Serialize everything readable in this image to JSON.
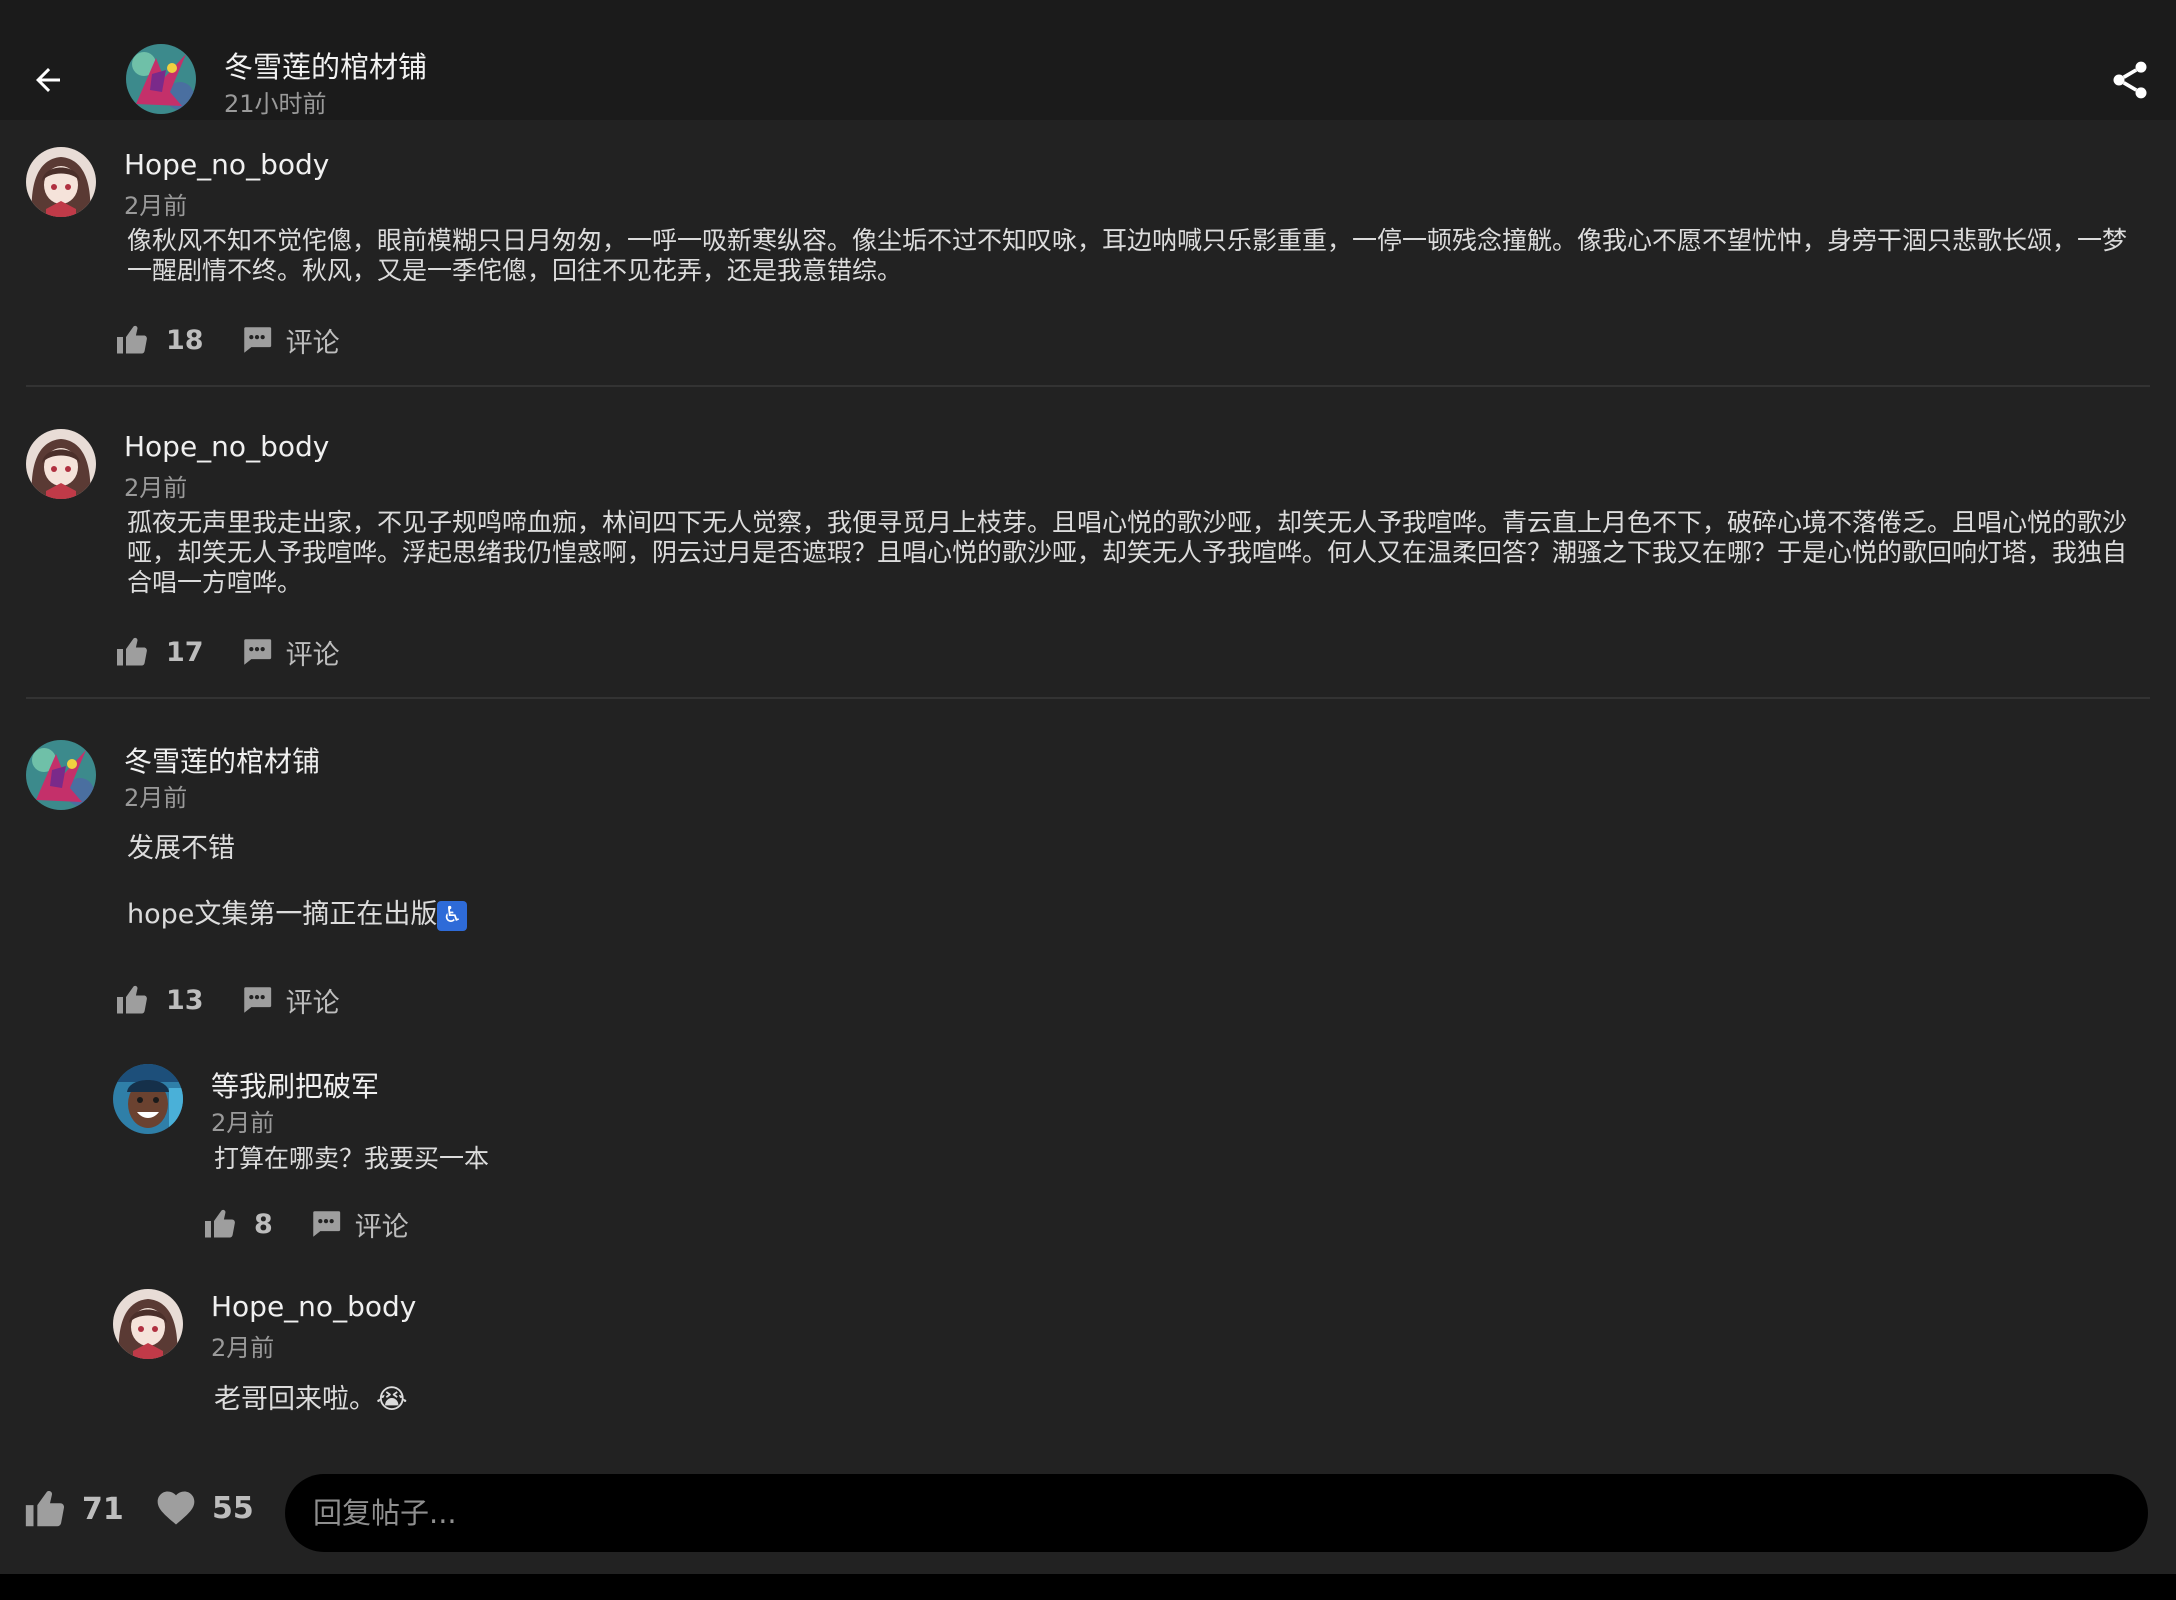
{
  "header": {
    "author": "冬雪莲的棺材铺",
    "time": "21小时前"
  },
  "comments": [
    {
      "user": "Hope_no_body",
      "time": "2月前",
      "text": "像秋风不知不觉侘傯，眼前模糊只日月匆匆，一呼一吸新寒纵容。像尘垢不过不知叹咏，耳边呐喊只乐影重重，一停一顿残念撞觥。像我心不愿不望忧忡，身旁干涸只悲歌长颂，一梦一醒剧情不终。秋风，又是一季侘傯，回往不见花弄，还是我意错综。",
      "likes": "18",
      "reply_label": "评论"
    },
    {
      "user": "Hope_no_body",
      "time": "2月前",
      "text": "孤夜无声里我走出家，不见子规鸣啼血痂，林间四下无人觉察，我便寻觅月上枝芽。且唱心悦的歌沙哑，却笑无人予我喧哗。青云直上月色不下，破碎心境不落倦乏。且唱心悦的歌沙哑，却笑无人予我喧哗。浮起思绪我仍惶惑啊，阴云过月是否遮瑕？且唱心悦的歌沙哑，却笑无人予我喧哗。何人又在温柔回答？潮骚之下我又在哪？于是心悦的歌回响灯塔，我独自合唱一方喧哗。",
      "likes": "17",
      "reply_label": "评论"
    },
    {
      "user": "冬雪莲的棺材铺",
      "time": "2月前",
      "text_line1": "发展不错",
      "text_line2": "hope文集第一摘正在出版",
      "emoji": "♿",
      "likes": "13",
      "reply_label": "评论"
    }
  ],
  "replies": [
    {
      "user": "等我刷把破军",
      "time": "2月前",
      "text": "打算在哪卖？我要买一本",
      "likes": "8",
      "reply_label": "评论"
    },
    {
      "user": "Hope_no_body",
      "time": "2月前",
      "text": "老哥回来啦。",
      "emoji": "😭"
    }
  ],
  "bottom": {
    "likes": "71",
    "favorites": "55",
    "reply_placeholder": "回复帖子..."
  },
  "colors": {
    "background": "#222222",
    "header_bg": "#1b1b1b",
    "input_bg": "#000000",
    "icon": "#9e9e9e"
  }
}
